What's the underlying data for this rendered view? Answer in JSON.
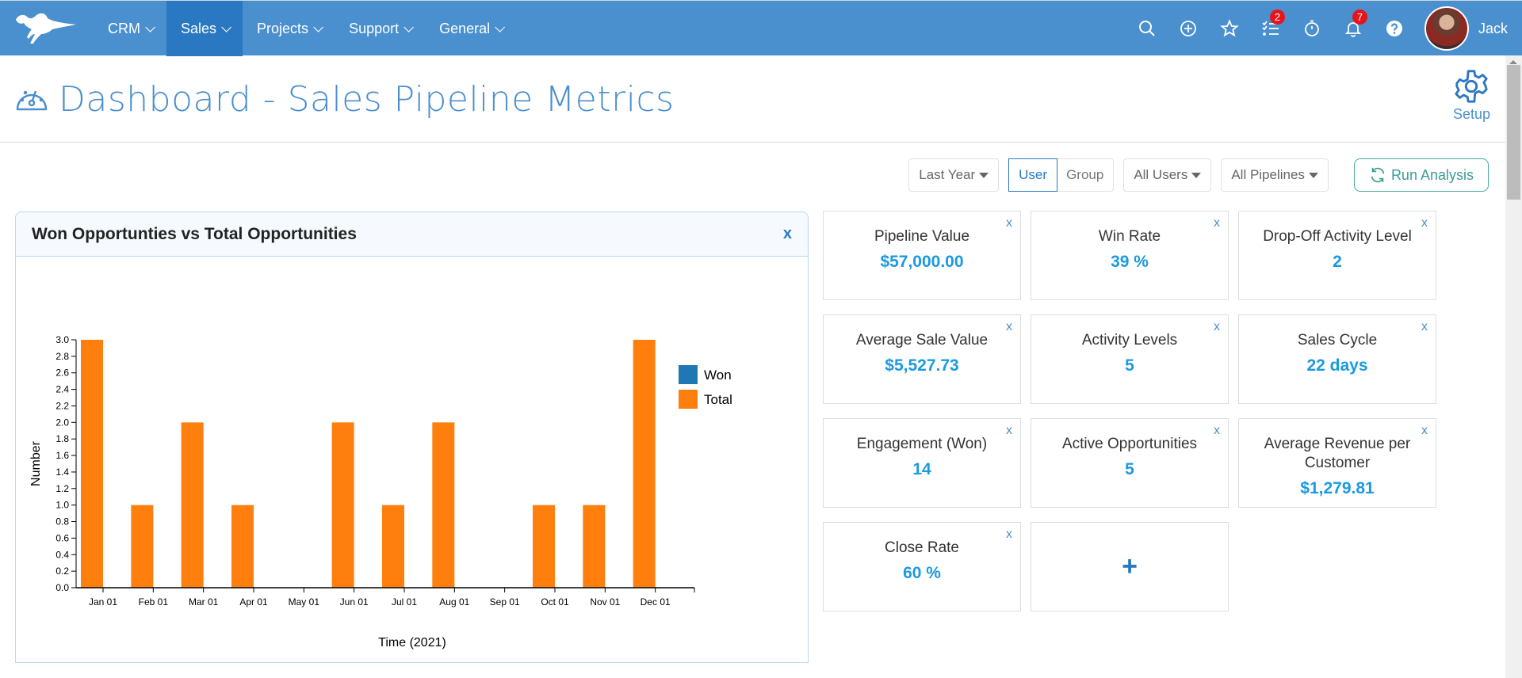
{
  "nav": {
    "logo": "camel-logo",
    "menu": [
      {
        "label": "CRM",
        "active": false
      },
      {
        "label": "Sales",
        "active": true
      },
      {
        "label": "Projects",
        "active": false
      },
      {
        "label": "Support",
        "active": false
      },
      {
        "label": "General",
        "active": false
      }
    ],
    "icons": [
      {
        "name": "search-icon"
      },
      {
        "name": "add-circle-icon"
      },
      {
        "name": "star-icon"
      },
      {
        "name": "tasks-icon",
        "badge": "2"
      },
      {
        "name": "timer-icon"
      },
      {
        "name": "bell-icon",
        "badge": "7"
      },
      {
        "name": "help-icon"
      }
    ],
    "user": {
      "name": "Jack"
    }
  },
  "header": {
    "title": "Dashboard - Sales Pipeline Metrics",
    "setup_label": "Setup"
  },
  "filters": {
    "period": "Last Year",
    "scope_options": [
      "User",
      "Group"
    ],
    "scope_selected": "User",
    "users": "All Users",
    "pipelines": "All Pipelines",
    "run_label": "Run Analysis"
  },
  "chart_panel": {
    "title": "Won Opportunties vs Total Opportunities",
    "close_label": "x"
  },
  "chart_data": {
    "type": "bar",
    "title": "Won Opportunties vs Total Opportunities",
    "xlabel": "Time (2021)",
    "ylabel": "Number",
    "categories": [
      "Jan 01",
      "Feb 01",
      "Mar 01",
      "Apr 01",
      "May 01",
      "Jun 01",
      "Jul 01",
      "Aug 01",
      "Sep 01",
      "Oct 01",
      "Nov 01",
      "Dec 01"
    ],
    "series": [
      {
        "name": "Won",
        "color": "#1f77b4",
        "values": [
          0,
          0,
          0,
          0,
          0,
          0,
          0,
          0,
          0,
          0,
          0,
          0
        ]
      },
      {
        "name": "Total",
        "color": "#ff7f0e",
        "values": [
          3,
          1,
          2,
          1,
          0,
          2,
          1,
          2,
          0,
          1,
          1,
          3
        ]
      }
    ],
    "ylim": [
      0,
      3.0
    ],
    "yticks": [
      "0.0",
      "0.2",
      "0.4",
      "0.6",
      "0.8",
      "1.0",
      "1.2",
      "1.4",
      "1.6",
      "1.8",
      "2.0",
      "2.2",
      "2.4",
      "2.6",
      "2.8",
      "3.0"
    ],
    "grid": false,
    "legend": "top-right"
  },
  "metrics": [
    {
      "label": "Pipeline Value",
      "value": "$57,000.00"
    },
    {
      "label": "Win Rate",
      "value": "39 %"
    },
    {
      "label": "Drop-Off Activity Level",
      "value": "2"
    },
    {
      "label": "Average Sale Value",
      "value": "$5,527.73"
    },
    {
      "label": "Activity Levels",
      "value": "5"
    },
    {
      "label": "Sales Cycle",
      "value": "22 days"
    },
    {
      "label": "Engagement (Won)",
      "value": "14"
    },
    {
      "label": "Active Opportunities",
      "value": "5"
    },
    {
      "label": "Average Revenue per Customer",
      "value": "$1,279.81"
    },
    {
      "label": "Close Rate",
      "value": "60 %"
    }
  ],
  "add_card_label": "+",
  "card_close_label": "x",
  "colors": {
    "nav_bg": "#4a8fce",
    "nav_active": "#2a78c1",
    "metric_value": "#1a9ae0",
    "run_button": "#3a9c92",
    "badge": "#e8141a"
  }
}
